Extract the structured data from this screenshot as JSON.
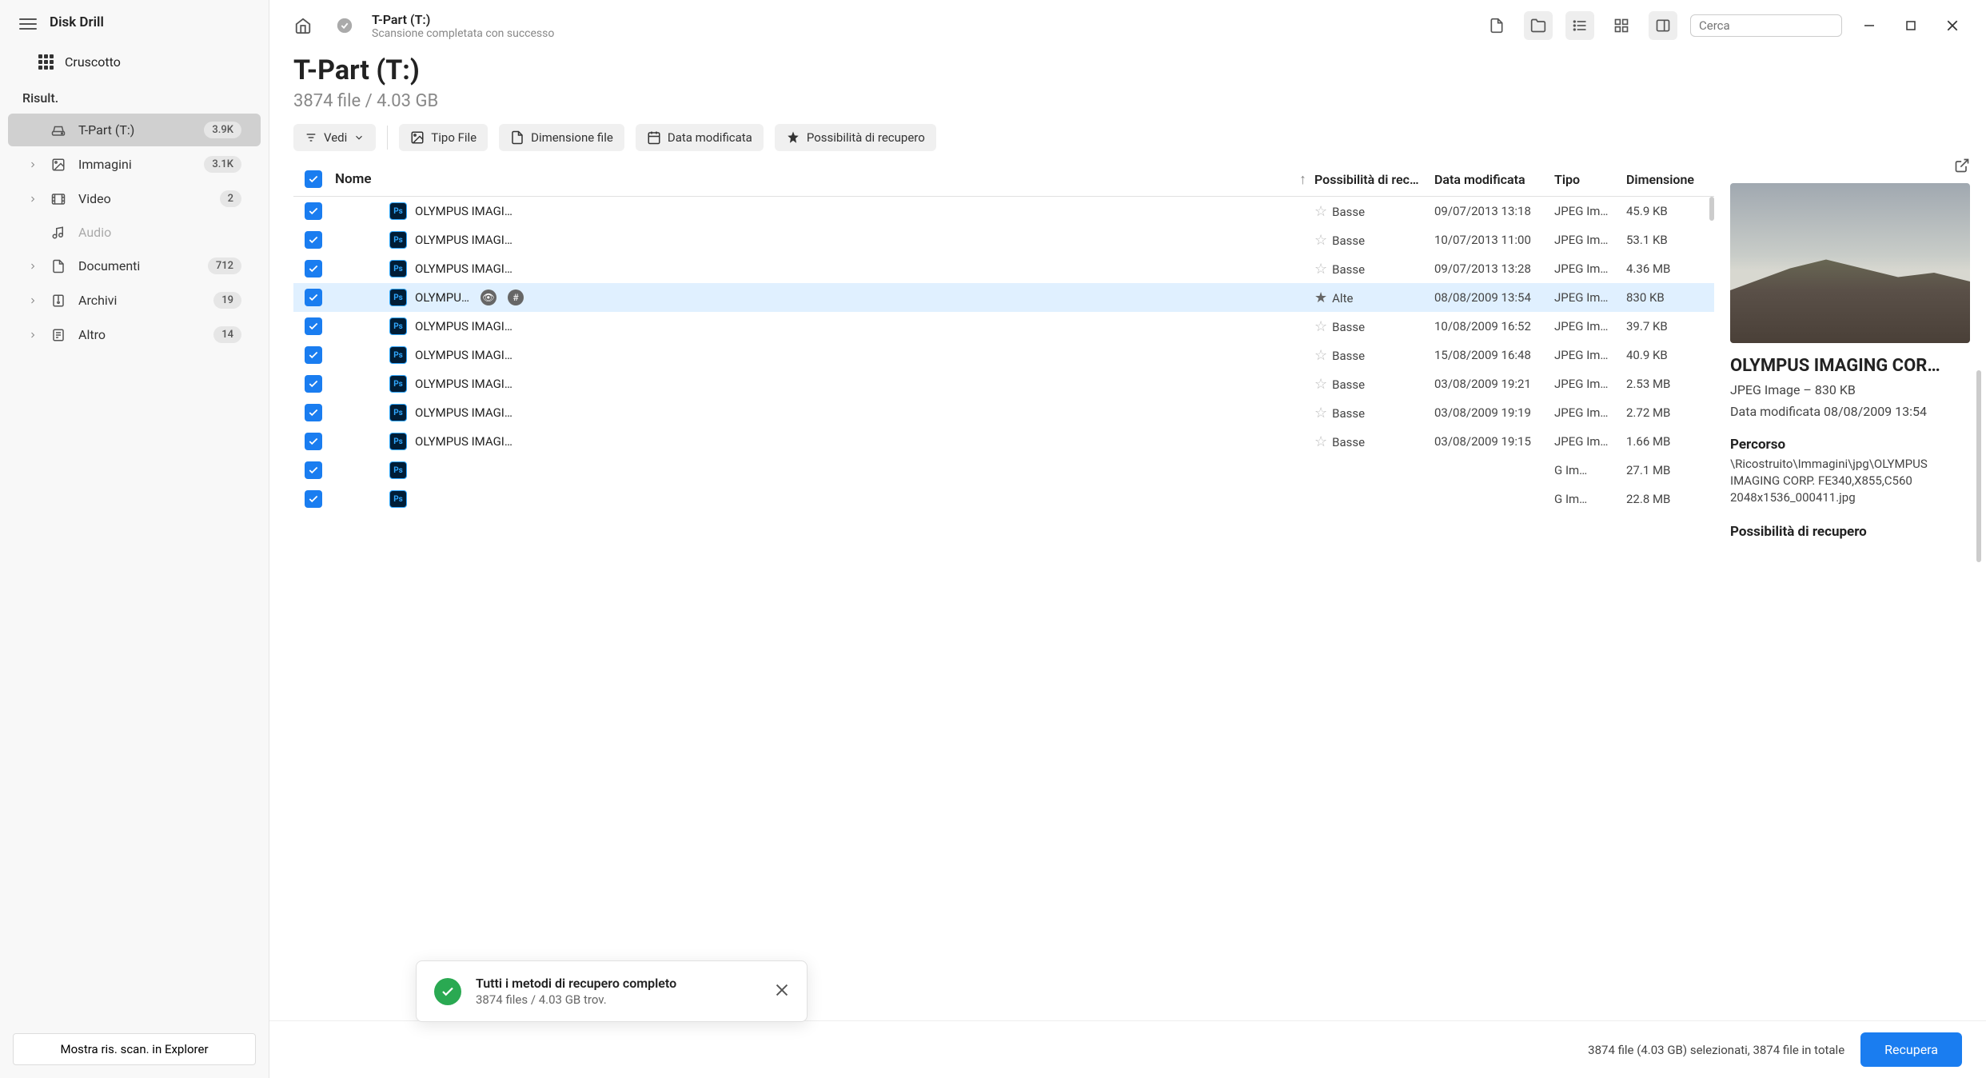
{
  "app_title": "Disk Drill",
  "sidebar": {
    "dashboard_label": "Cruscotto",
    "section_label": "Risult.",
    "items": [
      {
        "icon": "hdd",
        "label": "T-Part (T:)",
        "badge": "3.9K",
        "sel": true,
        "exp": false
      },
      {
        "icon": "image",
        "label": "Immagini",
        "badge": "3.1K",
        "sel": false,
        "exp": true
      },
      {
        "icon": "video",
        "label": "Video",
        "badge": "2",
        "sel": false,
        "exp": true
      },
      {
        "icon": "audio",
        "label": "Audio",
        "badge": "",
        "sel": false,
        "exp": false,
        "dim": true
      },
      {
        "icon": "doc",
        "label": "Documenti",
        "badge": "712",
        "sel": false,
        "exp": true
      },
      {
        "icon": "archive",
        "label": "Archivi",
        "badge": "19",
        "sel": false,
        "exp": true
      },
      {
        "icon": "other",
        "label": "Altro",
        "badge": "14",
        "sel": false,
        "exp": true
      }
    ],
    "show_explorer": "Mostra ris. scan. in Explorer"
  },
  "topbar": {
    "title": "T-Part (T:)",
    "subtitle": "Scansione completata con successo",
    "search_placeholder": "Cerca"
  },
  "page": {
    "title": "T-Part (T:)",
    "subtitle": "3874 file / 4.03 GB"
  },
  "toolbar": {
    "view": "Vedi",
    "filetype": "Tipo File",
    "filesize": "Dimensione file",
    "datemod": "Data modificata",
    "recovery": "Possibilità di recupero"
  },
  "columns": {
    "name": "Nome",
    "chance": "Possibilità di rec…",
    "date": "Data modificata",
    "type": "Tipo",
    "size": "Dimensione"
  },
  "rows": [
    {
      "name": "OLYMPUS IMAGI…",
      "chance": "Basse",
      "date": "09/07/2013 13:18",
      "type": "JPEG Im…",
      "size": "45.9 KB",
      "sel": false
    },
    {
      "name": "OLYMPUS IMAGI…",
      "chance": "Basse",
      "date": "10/07/2013 11:00",
      "type": "JPEG Im…",
      "size": "53.1 KB",
      "sel": false
    },
    {
      "name": "OLYMPUS IMAGI…",
      "chance": "Basse",
      "date": "09/07/2013 13:28",
      "type": "JPEG Im…",
      "size": "4.36 MB",
      "sel": false
    },
    {
      "name": "OLYMPU…",
      "chance": "Alte",
      "date": "08/08/2009 13:54",
      "type": "JPEG Im…",
      "size": "830 KB",
      "sel": true,
      "icons": true
    },
    {
      "name": "OLYMPUS IMAGI…",
      "chance": "Basse",
      "date": "10/08/2009 16:52",
      "type": "JPEG Im…",
      "size": "39.7 KB",
      "sel": false
    },
    {
      "name": "OLYMPUS IMAGI…",
      "chance": "Basse",
      "date": "15/08/2009 16:48",
      "type": "JPEG Im…",
      "size": "40.9 KB",
      "sel": false
    },
    {
      "name": "OLYMPUS IMAGI…",
      "chance": "Basse",
      "date": "03/08/2009 19:21",
      "type": "JPEG Im…",
      "size": "2.53 MB",
      "sel": false
    },
    {
      "name": "OLYMPUS IMAGI…",
      "chance": "Basse",
      "date": "03/08/2009 19:19",
      "type": "JPEG Im…",
      "size": "2.72 MB",
      "sel": false
    },
    {
      "name": "OLYMPUS IMAGI…",
      "chance": "Basse",
      "date": "03/08/2009 19:15",
      "type": "JPEG Im…",
      "size": "1.66 MB",
      "sel": false
    },
    {
      "name": "",
      "chance": "",
      "date": "",
      "type": "G Im…",
      "size": "27.1 MB",
      "sel": false,
      "hidden": true
    },
    {
      "name": "",
      "chance": "",
      "date": "",
      "type": "G Im…",
      "size": "22.8 MB",
      "sel": false,
      "hidden": true
    }
  ],
  "preview": {
    "title": "OLYMPUS IMAGING COR…",
    "meta": "JPEG Image – 830 KB",
    "date": "Data modificata 08/08/2009 13:54",
    "path_label": "Percorso",
    "path": "\\Ricostruito\\Immagini\\jpg\\OLYMPUS IMAGING CORP. FE340,X855,C560 2048x1536_000411.jpg",
    "recovery_label": "Possibilità di recupero"
  },
  "toast": {
    "title": "Tutti i metodi di recupero completo",
    "sub": "3874 files / 4.03 GB trov."
  },
  "footer": {
    "text": "3874 file (4.03 GB) selezionati, 3874 file in totale",
    "recover": "Recupera"
  }
}
